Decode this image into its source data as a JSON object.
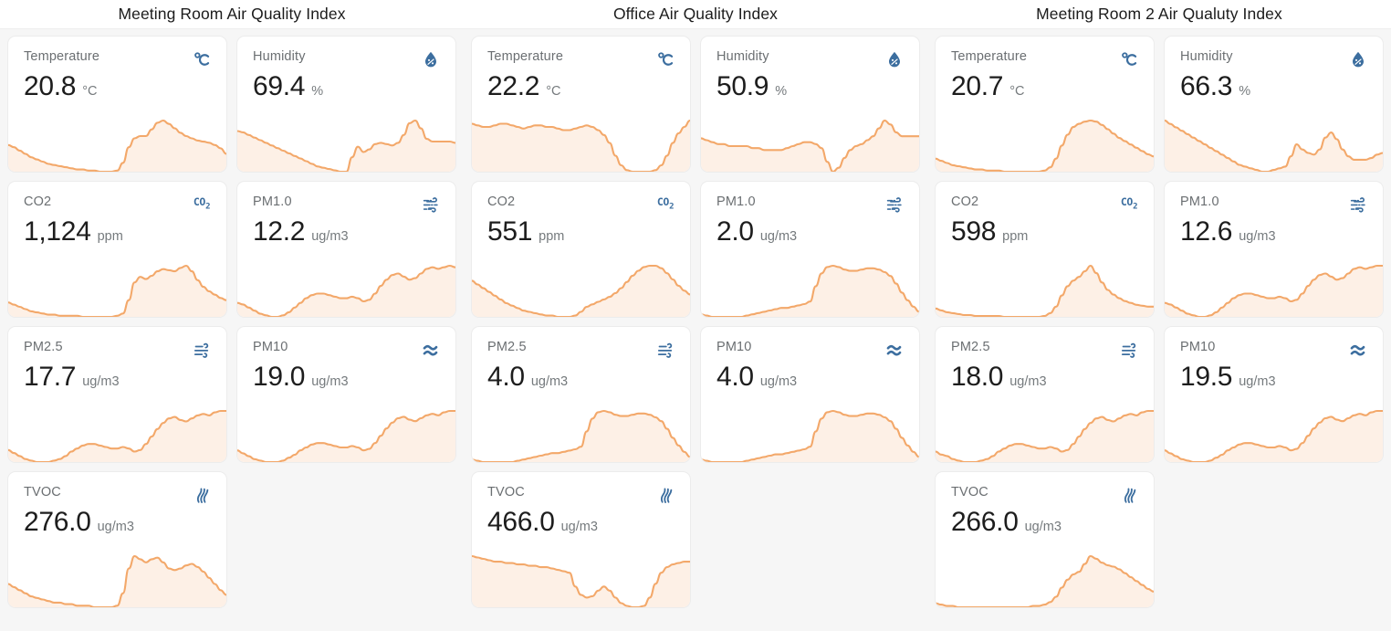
{
  "panels": [
    {
      "title": "Meeting Room Air Quality Index",
      "cards": [
        {
          "label": "Temperature",
          "value": "20.8",
          "unit": "°C",
          "icon": "celsius-icon",
          "spark": [
            38,
            36,
            33,
            30,
            27,
            25,
            23,
            21,
            20,
            19,
            18,
            17,
            16,
            16,
            15,
            15,
            14,
            14,
            14,
            15,
            22,
            36,
            44,
            46,
            46,
            52,
            58,
            60,
            57,
            53,
            49,
            46,
            44,
            42,
            41,
            40,
            38,
            35,
            30
          ]
        },
        {
          "label": "Humidity",
          "value": "69.4",
          "unit": "%",
          "icon": "humidity-icon",
          "spark": [
            50,
            49,
            47,
            45,
            43,
            41,
            39,
            37,
            35,
            33,
            31,
            29,
            27,
            25,
            23,
            22,
            21,
            20,
            19,
            19,
            30,
            38,
            34,
            36,
            40,
            41,
            40,
            39,
            41,
            47,
            56,
            58,
            52,
            44,
            42,
            42,
            42,
            42,
            41
          ]
        },
        {
          "label": "CO2",
          "value": "1,124",
          "unit": "ppm",
          "icon": "co2-icon",
          "spark": [
            26,
            24,
            22,
            20,
            18,
            17,
            16,
            15,
            15,
            14,
            14,
            14,
            14,
            13,
            13,
            13,
            13,
            13,
            13,
            14,
            16,
            28,
            44,
            49,
            47,
            50,
            54,
            56,
            55,
            54,
            57,
            59,
            54,
            46,
            40,
            36,
            33,
            30,
            28
          ]
        },
        {
          "label": "PM1.0",
          "value": "12.2",
          "unit": "ug/m3",
          "icon": "pm1-icon",
          "spark": [
            27,
            26,
            24,
            22,
            20,
            19,
            18,
            18,
            19,
            21,
            24,
            27,
            30,
            32,
            33,
            33,
            32,
            31,
            30,
            30,
            31,
            30,
            28,
            29,
            33,
            38,
            42,
            45,
            46,
            44,
            42,
            43,
            46,
            49,
            50,
            49,
            50,
            51,
            50
          ]
        },
        {
          "label": "PM2.5",
          "value": "17.7",
          "unit": "ug/m3",
          "icon": "pm25-icon",
          "spark": [
            22,
            20,
            18,
            16,
            15,
            14,
            14,
            14,
            15,
            16,
            18,
            21,
            23,
            25,
            26,
            26,
            25,
            24,
            23,
            23,
            24,
            23,
            21,
            22,
            26,
            31,
            36,
            40,
            43,
            44,
            42,
            41,
            43,
            45,
            46,
            45,
            47,
            48,
            48
          ]
        },
        {
          "label": "PM10",
          "value": "19.0",
          "unit": "ug/m3",
          "icon": "pm10-icon",
          "spark": [
            23,
            21,
            19,
            17,
            16,
            15,
            15,
            15,
            16,
            18,
            20,
            23,
            25,
            27,
            28,
            28,
            27,
            26,
            25,
            25,
            26,
            25,
            23,
            24,
            28,
            33,
            38,
            42,
            45,
            46,
            44,
            43,
            45,
            47,
            48,
            47,
            49,
            50,
            50
          ]
        },
        {
          "label": "TVOC",
          "value": "276.0",
          "unit": "ug/m3",
          "icon": "tvoc-icon",
          "spark": [
            32,
            30,
            28,
            26,
            24,
            23,
            22,
            21,
            20,
            20,
            19,
            19,
            18,
            18,
            18,
            17,
            17,
            17,
            17,
            18,
            26,
            42,
            50,
            48,
            46,
            48,
            49,
            46,
            42,
            41,
            42,
            44,
            45,
            43,
            40,
            36,
            32,
            28,
            25
          ]
        }
      ]
    },
    {
      "title": "Office Air Quality Index",
      "cards": [
        {
          "label": "Temperature",
          "value": "22.2",
          "unit": "°C",
          "icon": "celsius-icon",
          "spark": [
            42,
            41,
            40,
            40,
            41,
            42,
            42,
            41,
            40,
            39,
            40,
            41,
            41,
            40,
            40,
            39,
            38,
            38,
            39,
            40,
            41,
            40,
            38,
            35,
            30,
            22,
            16,
            13,
            12,
            12,
            12,
            12,
            13,
            16,
            22,
            30,
            36,
            40,
            44
          ]
        },
        {
          "label": "Humidity",
          "value": "50.9",
          "unit": "%",
          "icon": "humidity-icon",
          "spark": [
            45,
            44,
            43,
            42,
            42,
            41,
            41,
            41,
            41,
            40,
            40,
            39,
            39,
            39,
            39,
            40,
            41,
            42,
            43,
            43,
            42,
            40,
            33,
            28,
            30,
            35,
            39,
            41,
            42,
            44,
            46,
            50,
            54,
            52,
            48,
            46,
            46,
            46,
            46
          ]
        },
        {
          "label": "CO2",
          "value": "551",
          "unit": "ppm",
          "icon": "co2-icon",
          "spark": [
            45,
            42,
            39,
            36,
            33,
            30,
            27,
            25,
            23,
            21,
            20,
            19,
            18,
            17,
            17,
            16,
            16,
            16,
            17,
            20,
            24,
            26,
            28,
            30,
            32,
            35,
            39,
            44,
            49,
            53,
            56,
            57,
            57,
            55,
            51,
            46,
            41,
            37,
            34
          ]
        },
        {
          "label": "PM1.0",
          "value": "2.0",
          "unit": "ug/m3",
          "icon": "pm1-icon",
          "spark": [
            14,
            13,
            12,
            12,
            12,
            12,
            12,
            12,
            13,
            14,
            15,
            16,
            17,
            18,
            19,
            19,
            20,
            21,
            22,
            24,
            36,
            46,
            51,
            52,
            51,
            49,
            48,
            48,
            49,
            50,
            50,
            49,
            47,
            44,
            38,
            31,
            25,
            20,
            16
          ]
        },
        {
          "label": "PM2.5",
          "value": "4.0",
          "unit": "ug/m3",
          "icon": "pm25-icon",
          "spark": [
            14,
            13,
            12,
            12,
            12,
            12,
            12,
            12,
            13,
            14,
            15,
            16,
            17,
            18,
            19,
            19,
            20,
            21,
            22,
            24,
            36,
            46,
            51,
            52,
            51,
            49,
            48,
            48,
            49,
            50,
            50,
            49,
            47,
            44,
            38,
            31,
            25,
            20,
            16
          ]
        },
        {
          "label": "PM10",
          "value": "4.0",
          "unit": "ug/m3",
          "icon": "pm10-icon",
          "spark": [
            15,
            14,
            13,
            13,
            13,
            13,
            13,
            13,
            14,
            15,
            16,
            17,
            18,
            19,
            19,
            20,
            21,
            22,
            23,
            25,
            37,
            47,
            52,
            53,
            52,
            50,
            49,
            49,
            50,
            51,
            51,
            50,
            48,
            45,
            39,
            32,
            26,
            21,
            17
          ]
        },
        {
          "label": "TVOC",
          "value": "466.0",
          "unit": "ug/m3",
          "icon": "tvoc-icon",
          "spark": [
            52,
            51,
            50,
            49,
            48,
            48,
            47,
            47,
            46,
            46,
            45,
            45,
            44,
            44,
            43,
            42,
            41,
            40,
            30,
            24,
            22,
            23,
            27,
            30,
            27,
            22,
            18,
            16,
            15,
            15,
            16,
            22,
            32,
            40,
            44,
            46,
            47,
            48,
            48
          ]
        }
      ]
    },
    {
      "title": "Meeting Room 2 Air Qualuty Index",
      "cards": [
        {
          "label": "Temperature",
          "value": "20.7",
          "unit": "°C",
          "icon": "celsius-icon",
          "spark": [
            26,
            24,
            22,
            20,
            19,
            18,
            17,
            16,
            16,
            15,
            15,
            15,
            14,
            14,
            14,
            14,
            14,
            14,
            14,
            15,
            18,
            26,
            38,
            48,
            55,
            58,
            60,
            61,
            60,
            57,
            53,
            49,
            45,
            42,
            39,
            36,
            33,
            30,
            28
          ]
        },
        {
          "label": "Humidity",
          "value": "66.3",
          "unit": "%",
          "icon": "humidity-icon",
          "spark": [
            55,
            53,
            51,
            49,
            47,
            45,
            43,
            41,
            39,
            37,
            35,
            33,
            31,
            29,
            28,
            27,
            26,
            25,
            25,
            26,
            27,
            28,
            34,
            41,
            38,
            36,
            35,
            38,
            45,
            48,
            44,
            38,
            34,
            32,
            32,
            32,
            33,
            35,
            36
          ]
        },
        {
          "label": "CO2",
          "value": "598",
          "unit": "ppm",
          "icon": "co2-icon",
          "spark": [
            22,
            20,
            18,
            17,
            16,
            15,
            15,
            14,
            14,
            14,
            14,
            14,
            13,
            13,
            13,
            13,
            13,
            13,
            13,
            14,
            17,
            24,
            36,
            46,
            52,
            56,
            62,
            68,
            60,
            50,
            42,
            37,
            33,
            30,
            28,
            26,
            25,
            24,
            24
          ]
        },
        {
          "label": "PM1.0",
          "value": "12.6",
          "unit": "ug/m3",
          "icon": "pm1-icon",
          "spark": [
            28,
            27,
            25,
            23,
            21,
            20,
            19,
            19,
            20,
            22,
            25,
            28,
            31,
            33,
            34,
            34,
            33,
            32,
            31,
            31,
            32,
            31,
            29,
            30,
            34,
            39,
            43,
            46,
            47,
            45,
            43,
            44,
            47,
            50,
            51,
            50,
            51,
            52,
            52
          ]
        },
        {
          "label": "PM2.5",
          "value": "18.0",
          "unit": "ug/m3",
          "icon": "pm25-icon",
          "spark": [
            22,
            20,
            19,
            17,
            16,
            15,
            15,
            15,
            16,
            17,
            19,
            22,
            24,
            26,
            27,
            27,
            26,
            25,
            24,
            24,
            25,
            24,
            22,
            23,
            27,
            32,
            37,
            41,
            44,
            45,
            43,
            42,
            44,
            46,
            47,
            46,
            48,
            49,
            49
          ]
        },
        {
          "label": "PM10",
          "value": "19.5",
          "unit": "ug/m3",
          "icon": "pm10-icon",
          "spark": [
            24,
            22,
            20,
            18,
            17,
            16,
            16,
            16,
            17,
            19,
            21,
            24,
            26,
            28,
            29,
            29,
            28,
            27,
            26,
            26,
            27,
            26,
            24,
            25,
            29,
            34,
            39,
            43,
            46,
            47,
            45,
            44,
            46,
            48,
            49,
            48,
            50,
            51,
            51
          ]
        },
        {
          "label": "TVOC",
          "value": "266.0",
          "unit": "ug/m3",
          "icon": "tvoc-icon",
          "spark": [
            18,
            17,
            16,
            16,
            15,
            15,
            15,
            15,
            15,
            15,
            15,
            15,
            15,
            15,
            15,
            15,
            15,
            16,
            16,
            17,
            19,
            23,
            30,
            36,
            40,
            42,
            48,
            54,
            52,
            49,
            47,
            46,
            44,
            41,
            38,
            35,
            32,
            29,
            27
          ]
        }
      ]
    }
  ],
  "colors": {
    "spark_stroke": "#f3a86a",
    "spark_fill": "#fdf0e6",
    "icon": "#3c6e9f",
    "value": "#1d1d1d",
    "label": "#6b6f72",
    "page_bg": "#f6f6f6",
    "card_bg": "#ffffff"
  }
}
